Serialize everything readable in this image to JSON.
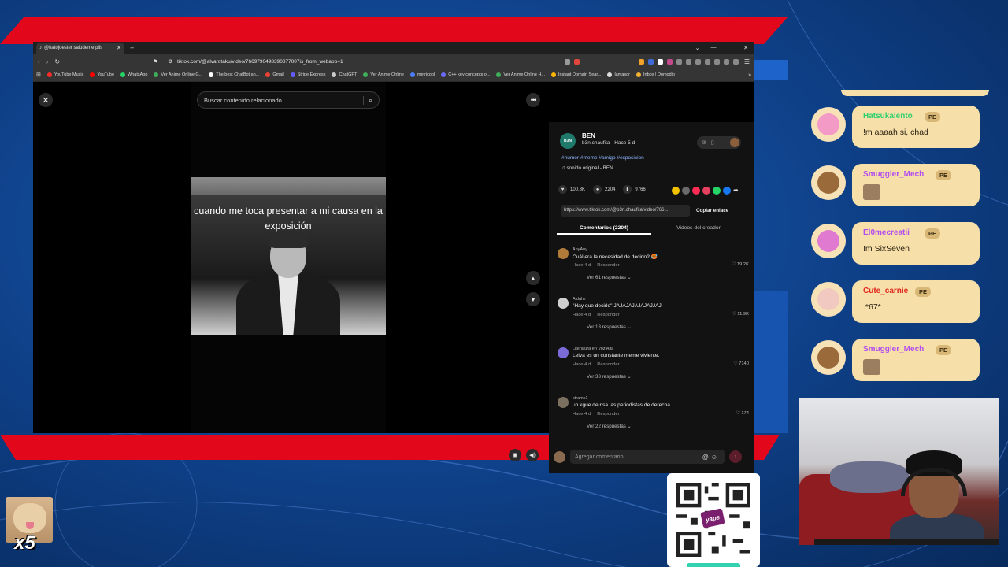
{
  "browser": {
    "tab_title": "@hatojoester saludeme plis",
    "url": "tiktok.com/@alvarotaku/video/7669790498390877007is_from_webapp=1",
    "bookmarks": [
      {
        "label": "YouTube Music",
        "color": "#ff2b2b"
      },
      {
        "label": "YouTube",
        "color": "#ff0000"
      },
      {
        "label": "WhatsApp",
        "color": "#25d366"
      },
      {
        "label": "Ver Anime Online G...",
        "color": "#3fae5a"
      },
      {
        "label": "The best ChatBot an...",
        "color": "#ffffff"
      },
      {
        "label": "Gmail",
        "color": "#ea4335"
      },
      {
        "label": "Stripe Express",
        "color": "#635bff"
      },
      {
        "label": "ChatGPT",
        "color": "#cccccc"
      },
      {
        "label": "Ver Anime Online",
        "color": "#3fae5a"
      },
      {
        "label": "metricool",
        "color": "#4a7dff"
      },
      {
        "label": "C++ key concepts o...",
        "color": "#6b6bff"
      },
      {
        "label": "Ver Anime Online H...",
        "color": "#3fae5a"
      },
      {
        "label": "Instant Domain Sear...",
        "color": "#ffb400"
      },
      {
        "label": "lamasor",
        "color": "#dddddd"
      },
      {
        "label": "Inbox | Domodip",
        "color": "#f2b233"
      }
    ]
  },
  "video": {
    "search_placeholder": "Buscar contenido relacionado",
    "caption": "cuando me toca presentar a mi causa en la exposición"
  },
  "author": {
    "avatar_text": "B3N",
    "name": "BEN",
    "handle_time": "b3n.chaufita · Hace 5 d",
    "hashtags": "#humor #meme #amigo #exposicion",
    "sound": "♫  sonido original - BEN"
  },
  "stats": {
    "likes": "100.8K",
    "comments": "2204",
    "saves": "9766"
  },
  "share_colors": [
    "#f2c200",
    "#7a7a7a",
    "#fe2c55",
    "#e4405f",
    "#25d366",
    "#1877f2",
    "#d8d8d8"
  ],
  "link": {
    "url": "https://www.tiktok.com/@b3n.chaufita/video/766...",
    "copy_label": "Copiar enlace"
  },
  "tabs": {
    "comments": "Comentarios (2204)",
    "creator_videos": "Videos del creador"
  },
  "comments": [
    {
      "user": "AnyAny",
      "text": "Cuál era la necesidad de decirlo? 🥵",
      "time": "Hace 4 d",
      "reply": "Responder",
      "likes": "♡ 19.2K",
      "replies": "Ver 61 respuestas ⌄",
      "avatar": "#b07a3a"
    },
    {
      "user": "Aldahir",
      "text": "\"Hay que decirlo\" JAJAJAJAJAJAJJAJ",
      "time": "Hace 4 d",
      "reply": "Responder",
      "likes": "♡ 11.9K",
      "replies": "Ver 13 respuestas ⌄",
      "avatar": "#cfcfcf"
    },
    {
      "user": "Literatura en Voz Alta",
      "text": "Leiva es un constante meme viviente.",
      "time": "Hace 4 d",
      "reply": "Responder",
      "likes": "♡ 7140",
      "replies": "Ver 33 respuestas ⌄",
      "avatar": "#7a6bd8"
    },
    {
      "user": "stramk1",
      "text": "un kgue de risa las periodistas de derecha",
      "time": "Hace 4 d",
      "reply": "Responder",
      "likes": "♡ 174",
      "replies": "Ver 22 respuestas ⌄",
      "avatar": "#7b7060"
    }
  ],
  "comment_box": {
    "placeholder": "Agregar comentario..."
  },
  "chat": [
    {
      "name": "Hatsukaiento",
      "name_color": "#2fd06f",
      "badge": "PE",
      "text": "!m aaaah si, chad",
      "face_color": "#f39ac7"
    },
    {
      "name": "Smuggler_Mech",
      "name_color": "#b24bf0",
      "badge": "PE",
      "text": "",
      "face_color": "#9a6a3a"
    },
    {
      "name": "El0mecreatii",
      "name_color": "#b24bf0",
      "badge": "PE",
      "text": "!m SixSeven",
      "face_color": "#e07ad0"
    },
    {
      "name": "Cute_carnie",
      "name_color": "#e0281e",
      "badge": "PE",
      "text": ".*67*",
      "face_color": "#f1c9c0"
    },
    {
      "name": "Smuggler_Mech",
      "name_color": "#b24bf0",
      "badge": "PE",
      "text": "",
      "face_color": "#9a6a3a"
    }
  ],
  "qr": {
    "brand": "yape"
  },
  "multiplier": "x5"
}
